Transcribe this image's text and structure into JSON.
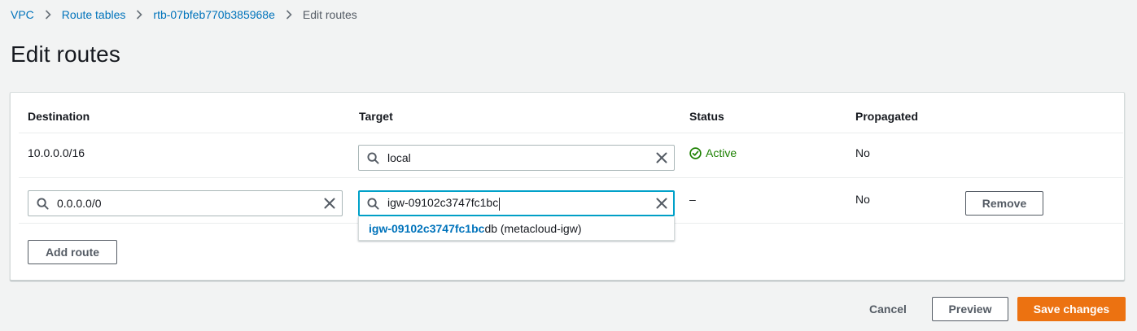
{
  "breadcrumb": {
    "items": [
      "VPC",
      "Route tables",
      "rtb-07bfeb770b385968e"
    ],
    "current": "Edit routes"
  },
  "page": {
    "title": "Edit routes"
  },
  "table": {
    "headers": {
      "destination": "Destination",
      "target": "Target",
      "status": "Status",
      "propagated": "Propagated"
    },
    "row1": {
      "destination": "10.0.0.0/16",
      "target": "local",
      "status": "Active",
      "propagated": "No"
    },
    "row2": {
      "destination": "0.0.0.0/0",
      "target": "igw-09102c3747fc1bc",
      "status": "–",
      "propagated": "No",
      "remove_label": "Remove"
    }
  },
  "suggestion": {
    "match": "igw-09102c3747fc1bc",
    "rest": "db (metacloud-igw)"
  },
  "add_route_label": "Add route",
  "footer": {
    "cancel": "Cancel",
    "preview": "Preview",
    "save": "Save changes"
  },
  "icons": {
    "search": "search-icon",
    "clear": "close-icon",
    "status": "check-circle-icon",
    "separator": "chevron-right-icon"
  },
  "colors": {
    "link": "#0073bb",
    "primary": "#ec7211",
    "success": "#1d8102",
    "focus": "#00a1c9"
  }
}
